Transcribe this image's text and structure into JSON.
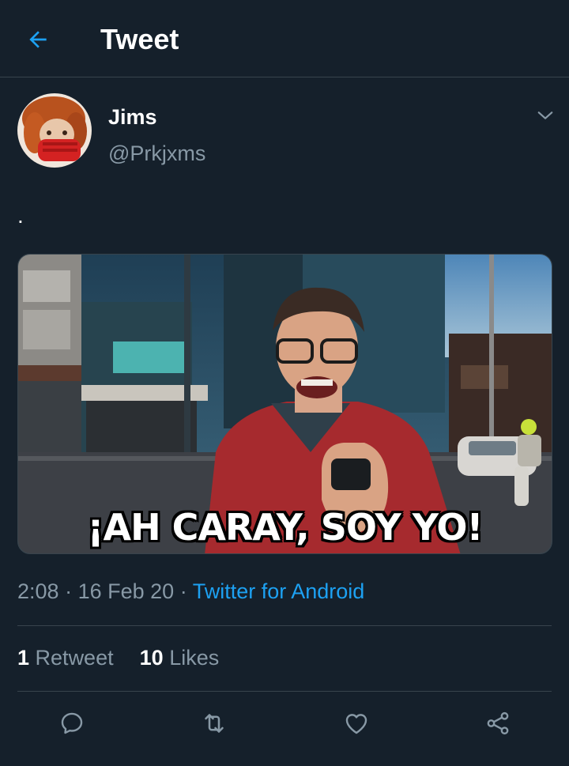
{
  "header": {
    "title": "Tweet",
    "back_icon": "arrow-left-icon",
    "accent": "#1da1f2"
  },
  "tweet": {
    "author": {
      "name": "Jims",
      "handle": "@Prkjxms"
    },
    "text": ".",
    "media": {
      "caption": "¡AH CARAY, SOY YO!"
    },
    "time": "2:08",
    "date": "16 Feb 20",
    "separator": "·",
    "source": "Twitter for Android"
  },
  "stats": {
    "retweets_count": "1",
    "retweets_label": "Retweet",
    "likes_count": "10",
    "likes_label": "Likes"
  },
  "actions": [
    "reply-icon",
    "retweet-icon",
    "like-icon",
    "share-icon"
  ],
  "colors": {
    "background": "#15202b",
    "border": "#38444d",
    "secondary_text": "#8899a6",
    "link": "#1da1f2"
  }
}
